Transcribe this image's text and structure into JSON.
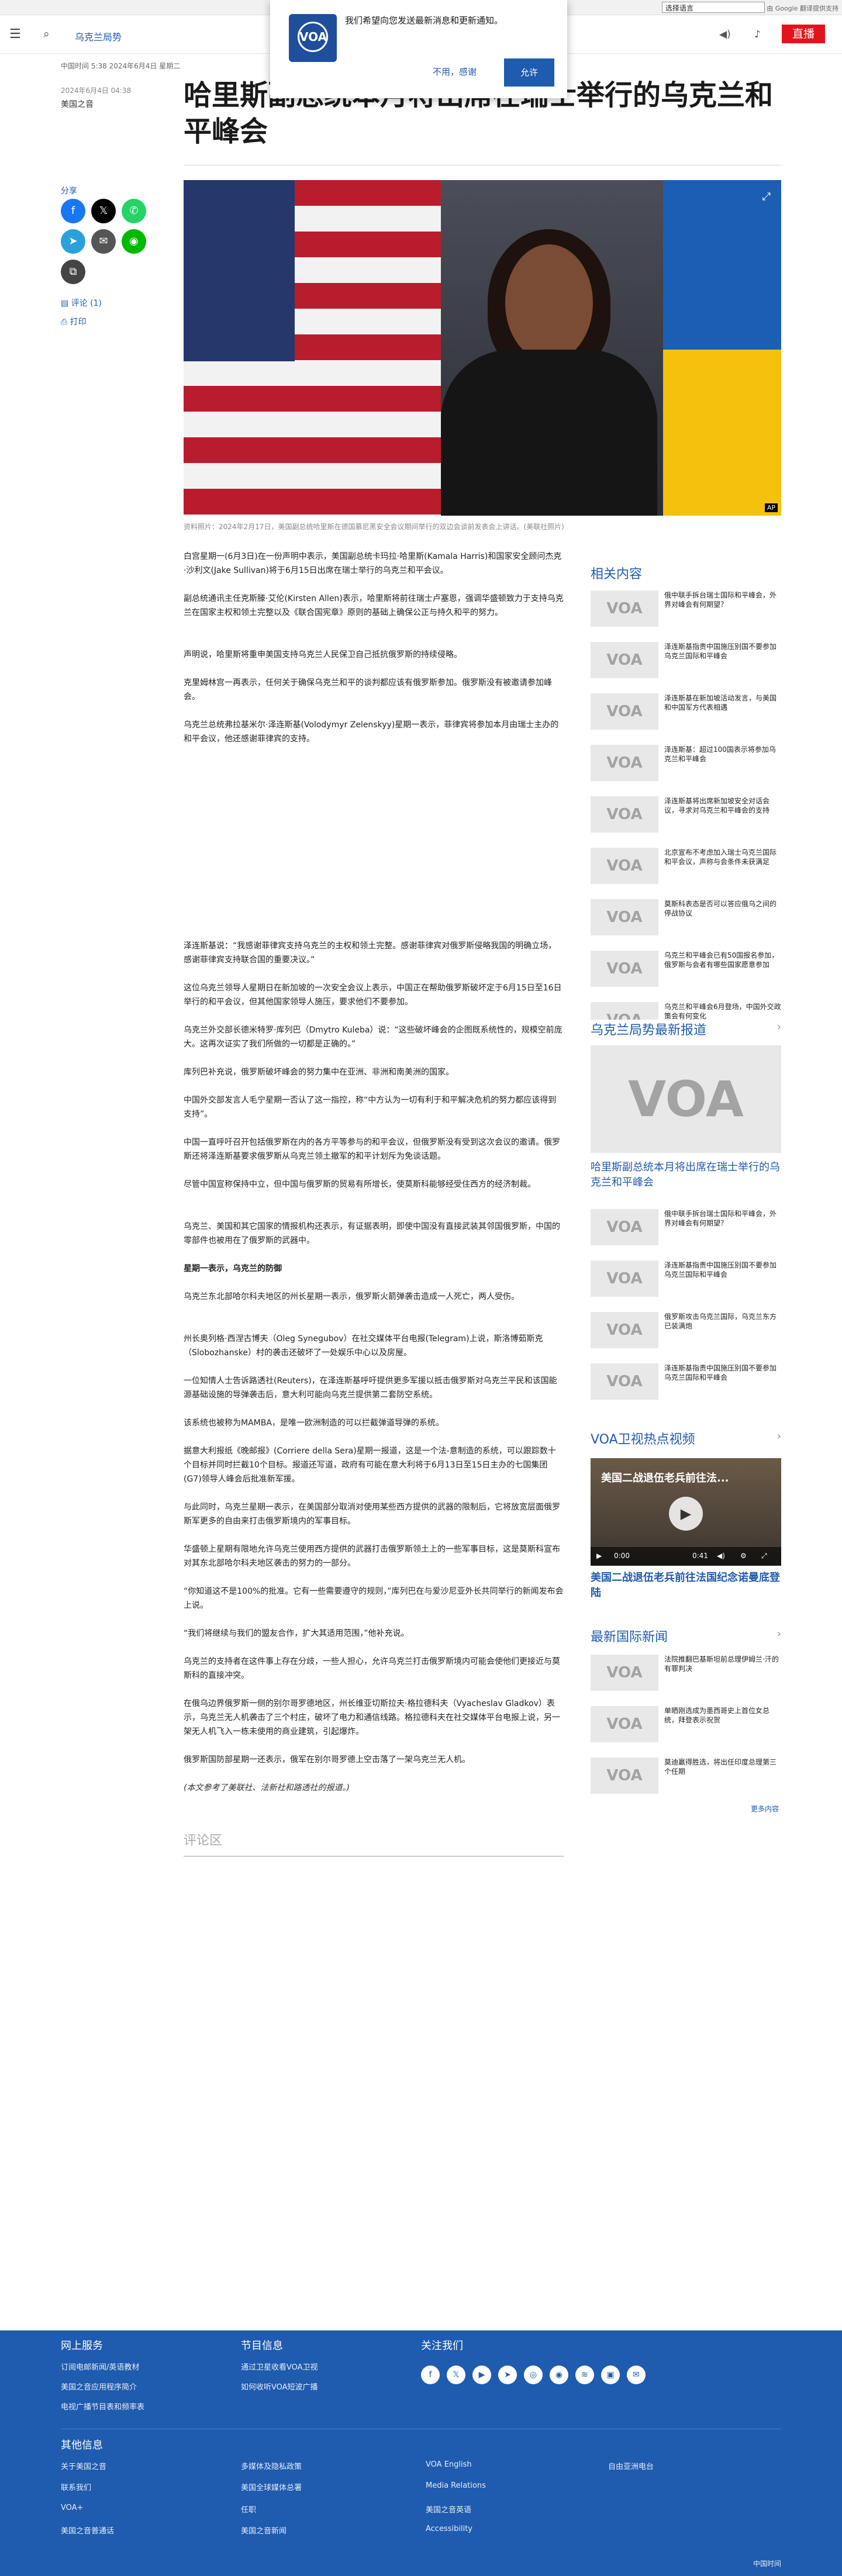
{
  "topbar": {
    "language_select": "选择语言",
    "powered_by": "由 Google 翻译提供支持"
  },
  "header": {
    "section": "乌克兰局势",
    "live": "直播"
  },
  "notification": {
    "message": "我们希望向您发送最新消息和更新通知。",
    "logo_text": "VOA",
    "logo_sub": "美国之音",
    "decline": "不用，感谢",
    "allow": "允许"
  },
  "article": {
    "date": "中国时间 5:38 2024年6月4日 星期二",
    "dateline": "2024年6月4日 04:38",
    "author": "美国之音",
    "title": "哈里斯副总统本月将出席在瑞士举行的乌克兰和平峰会",
    "share_label": "分享",
    "comments_link": "评论 (1)",
    "print_link": "打印",
    "photo_credit": "AP",
    "caption": "资料照片：2024年2月17日，美国副总统哈里斯在德国慕尼黑安全会议期间举行的双边会谈前发表会上讲话。(美联社照片)",
    "paragraphs": [
      "白宫星期一(6月3日)在一份声明中表示，美国副总统卡玛拉·哈里斯(Kamala Harris)和国家安全顾问杰克·沙利文(Jake Sullivan)将于6月15日出席在瑞士举行的乌克兰和平会议。",
      "副总统通讯主任克斯滕·艾伦(Kirsten Allen)表示，哈里斯将前往瑞士卢塞恩，强调华盛顿致力于支持乌克兰在国家主权和领土完整以及《联合国宪章》原则的基础上确保公正与持久和平的努力。",
      "声明说，哈里斯将重申美国支持乌克兰人民保卫自己抵抗俄罗斯的持续侵略。",
      "克里姆林宫一再表示，任何关于确保乌克兰和平的谈判都应该有俄罗斯参加。俄罗斯没有被邀请参加峰会。",
      "乌克兰总统弗拉基米尔·泽连斯基(Volodymyr Zelenskyy)星期一表示，菲律宾将参加本月由瑞士主办的和平会议，他还感谢菲律宾的支持。",
      "泽连斯基说：“我感谢菲律宾支持乌克兰的主权和领土完整。感谢菲律宾对俄罗斯侵略我国的明确立场，感谢菲律宾支持联合国的重要决议。”",
      "这位乌克兰领导人星期日在新加坡的一次安全会议上表示，中国正在帮助俄罗斯破坏定于6月15日至16日举行的和平会议，但其他国家领导人施压，要求他们不要参加。",
      "乌克兰外交部长德米特罗·库列巴（Dmytro Kuleba）说：“这些破坏峰会的企图既系统性的，规模空前庞大。这再次证实了我们所做的一切都是正确的。”",
      "库列巴补充说，俄罗斯破坏峰会的努力集中在亚洲、非洲和南美洲的国家。",
      "中国外交部发言人毛宁星期一否认了这一指控，称“中方认为一切有利于和平解决危机的努力都应该得到支持”。",
      "中国一直呼吁召开包括俄罗斯在内的各方平等参与的和平会议，但俄罗斯没有受到这次会议的邀请。俄罗斯还将泽连斯基要求俄罗斯从乌克兰领土撤军的和平计划斥为免谈话题。",
      "尽管中国宣称保持中立，但中国与俄罗斯的贸易有所增长，使莫斯科能够经受住西方的经济制裁。",
      "乌克兰、美国和其它国家的情报机构还表示，有证据表明，即使中国没有直接武装其邻国俄罗斯，中国的零部件也被用在了俄罗斯的武器中。",
      "星期一表示，乌克兰的防御",
      "乌克兰东北部哈尔科夫地区的州长星期一表示，俄罗斯火箭弹袭击造成一人死亡，两人受伤。",
      "州长奥列格·西涅古博夫（Oleg Synegubov）在社交媒体平台电报(Telegram)上说，斯洛博茹斯克（Slobozhanske）村的袭击还破坏了一处娱乐中心以及房屋。",
      "一位知情人士告诉路透社(Reuters)，在泽连斯基呼吁提供更多军援以抵击俄罗斯对乌克兰平民和该国能源基础设施的导弹袭击后，意大利可能向乌克兰提供第二套防空系统。",
      "该系统也被称为MAMBA，是唯一欧洲制造的可以拦截弹道导弹的系统。",
      "据意大利报纸《晚邮报》(Corriere della Sera)星期一报道，这是一个法-意制造的系统，可以跟踪数十个目标并同时拦截10个目标。报道还写道，政府有可能在意大利将于6月13日至15日主办的七国集团(G7)领导人峰会后批准新军援。",
      "与此同时，乌克兰星期一表示，在美国部分取消对使用某些西方提供的武器的限制后，它将放宽层面俄罗斯军更多的自由来打击俄罗斯境内的军事目标。",
      "华盛顿上星期有限地允许乌克兰使用西方提供的武器打击俄罗斯领土上的一些军事目标，这是莫斯科宣布对其东北部哈尔科夫地区袭击的努力的一部分。",
      "“你知道这不是100%的批准。它有一些需要遵守的规则，”库列巴在与爱沙尼亚外长共同举行的新闻发布会上说。",
      "“我们将继续与我们的盟友合作，扩大其适用范围，”他补充说。",
      "乌克兰的支持者在这件事上存在分歧，一些人担心，允许乌克兰打击俄罗斯境内可能会使他们更接近与莫斯科的直接冲突。",
      "在俄乌边界俄罗斯一侧的别尔哥罗德地区，州长维亚切斯拉夫·格拉德科夫（Vyacheslav Gladkov）表示，乌克兰无人机袭击了三个村庄，破坏了电力和通信线路。格拉德科夫在社交媒体平台电报上说，另一架无人机飞入一栋未使用的商业建筑，引起爆炸。",
      "俄罗斯国防部星期一还表示，俄军在别尔哥罗德上空击落了一架乌克兰无人机。",
      "(本文参考了美联社、法新社和路透社的报道。)"
    ],
    "comments_heading": "评论区"
  },
  "sidebar": {
    "related_heading": "相关内容",
    "related": [
      "俄中联手拆台瑞士国际和平峰会，外界对峰会有何期望？",
      "泽连斯基指责中国施压别国不要参加乌克兰国际和平峰会",
      "泽连斯基在新加坡活动发言，与美国和中国军方代表相遇",
      "泽连斯基：超过100国表示将参加乌克兰和平峰会",
      "泽连斯基将出席新加坡安全对话会议，寻求对乌克兰和平峰会的支持",
      "北京宣布不考虑加入瑞士乌克兰国际和平会议，声称与会条件未获满足",
      "莫斯科表态是否可以答应俄乌之间的停战协议",
      "乌克兰和平峰会已有50国报名参加，俄罗斯与会者有哪些国家愿意参加",
      "乌克兰和平峰会6月登场，中国外交政策会有何变化"
    ],
    "special_heading": "乌克兰局势最新报道",
    "special_title": "哈里斯副总统本月将出席在瑞士举行的乌克兰和平峰会",
    "special": [
      "俄中联手拆台瑞士国际和平峰会，外界对峰会有何期望？",
      "泽连斯基指责中国施压别国不要参加乌克兰国际和平峰会",
      "俄罗斯攻击乌克兰国际，乌克兰东方已装满炮",
      "泽连斯基指责中国施压别国不要参加乌克兰国际和平峰会"
    ],
    "video_heading": "VOA卫视热点视频",
    "video_overlay": "美国二战退伍老兵前往法...",
    "video_time_start": "0:00",
    "video_time_end": "0:41",
    "video_title": "美国二战退伍老兵前往法国纪念诺曼底登陆",
    "news_heading": "最新国际新闻",
    "news": [
      "法院推翻巴基斯坦前总理伊姆兰·汗的有罪判决",
      "单晒刚选成为墨西哥史上首位女总统，拜登表示祝贺",
      "莫迪赢得胜选，将出任印度总理第三个任期"
    ],
    "more": "更多内容"
  },
  "footer": {
    "col1_heading": "网上服务",
    "col1_links": [
      "订阅电邮新闻/英语教材",
      "美国之音应用程序简介",
      "电视广播节目表和频率表"
    ],
    "col2_heading": "节目信息",
    "col2_links": [
      "通过卫星收看VOA卫视",
      "如何收听VOA短波广播"
    ],
    "col3_heading": "关注我们",
    "social_icons": [
      "facebook-icon",
      "x-icon",
      "youtube-icon",
      "telegram-icon",
      "instagram-icon",
      "podcast-icon",
      "rss-icon",
      "app-icon",
      "email-icon"
    ],
    "other_heading": "其他信息",
    "other_links": [
      "关于美国之音",
      "多媒体及隐私政策",
      "VOA English",
      "自由亚洲电台",
      "联系我们",
      "美国全球媒体总署",
      "Media Relations",
      "Accessibility",
      "VOA+",
      "任职",
      "美国之音英语",
      "美国之音普通话",
      "美国之音新闻"
    ],
    "timezone": "中国时间"
  },
  "colors": {
    "brand": "#1f5bae",
    "live": "#e3131b"
  }
}
